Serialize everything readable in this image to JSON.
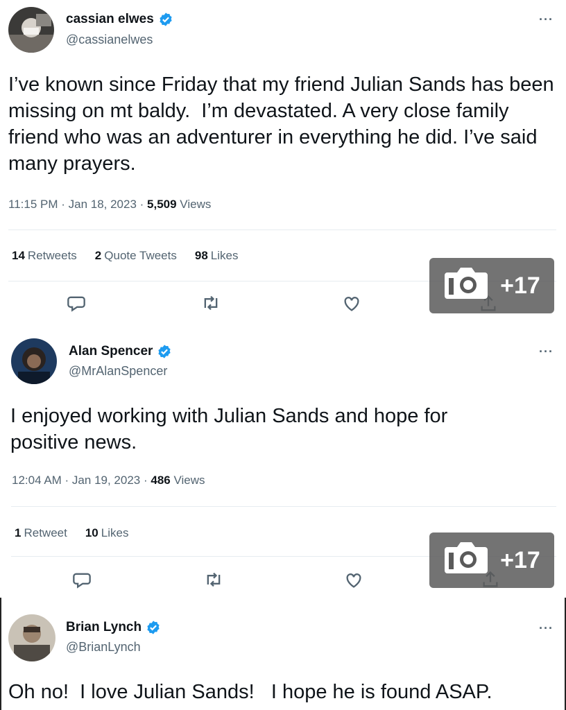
{
  "tweets": [
    {
      "name": "cassian elwes",
      "handle": "@cassianelwes",
      "text": "I’ve known since Friday that my friend Julian Sands has been missing on mt baldy.  I’m devastated. A very close family friend who was an adventurer in everything he did. I’ve said many prayers.",
      "time": "11:15 PM · Jan 18, 2023 · ",
      "views_count": "5,509",
      "views_label": " Views",
      "retweets": {
        "count": "14",
        "label": "Retweets"
      },
      "quotes": {
        "count": "2",
        "label": "Quote Tweets"
      },
      "likes": {
        "count": "98",
        "label": "Likes"
      }
    },
    {
      "name": "Alan Spencer",
      "handle": "@MrAlanSpencer",
      "text": "I enjoyed working with Julian Sands and hope for positive news.",
      "time": "12:04 AM · Jan 19, 2023 · ",
      "views_count": "486",
      "views_label": " Views",
      "retweets": {
        "count": "1",
        "label": "Retweet"
      },
      "likes": {
        "count": "10",
        "label": "Likes"
      }
    },
    {
      "name": "Brian Lynch",
      "handle": "@BrianLynch",
      "text": "Oh no!  I love Julian Sands!   I hope he is found ASAP."
    }
  ],
  "photo_badge": {
    "label": "+17",
    "icon": "camera-icon"
  },
  "icons": {
    "reply": "comment-icon",
    "retweet": "retweet-icon",
    "like": "heart-icon",
    "share": "share-icon",
    "verified": "verified-badge-icon",
    "more": "more-options-icon"
  },
  "more_glyph": "···",
  "colors": {
    "verified": "#1d9bf0",
    "secondary": "#536471",
    "text": "#0f1419"
  }
}
